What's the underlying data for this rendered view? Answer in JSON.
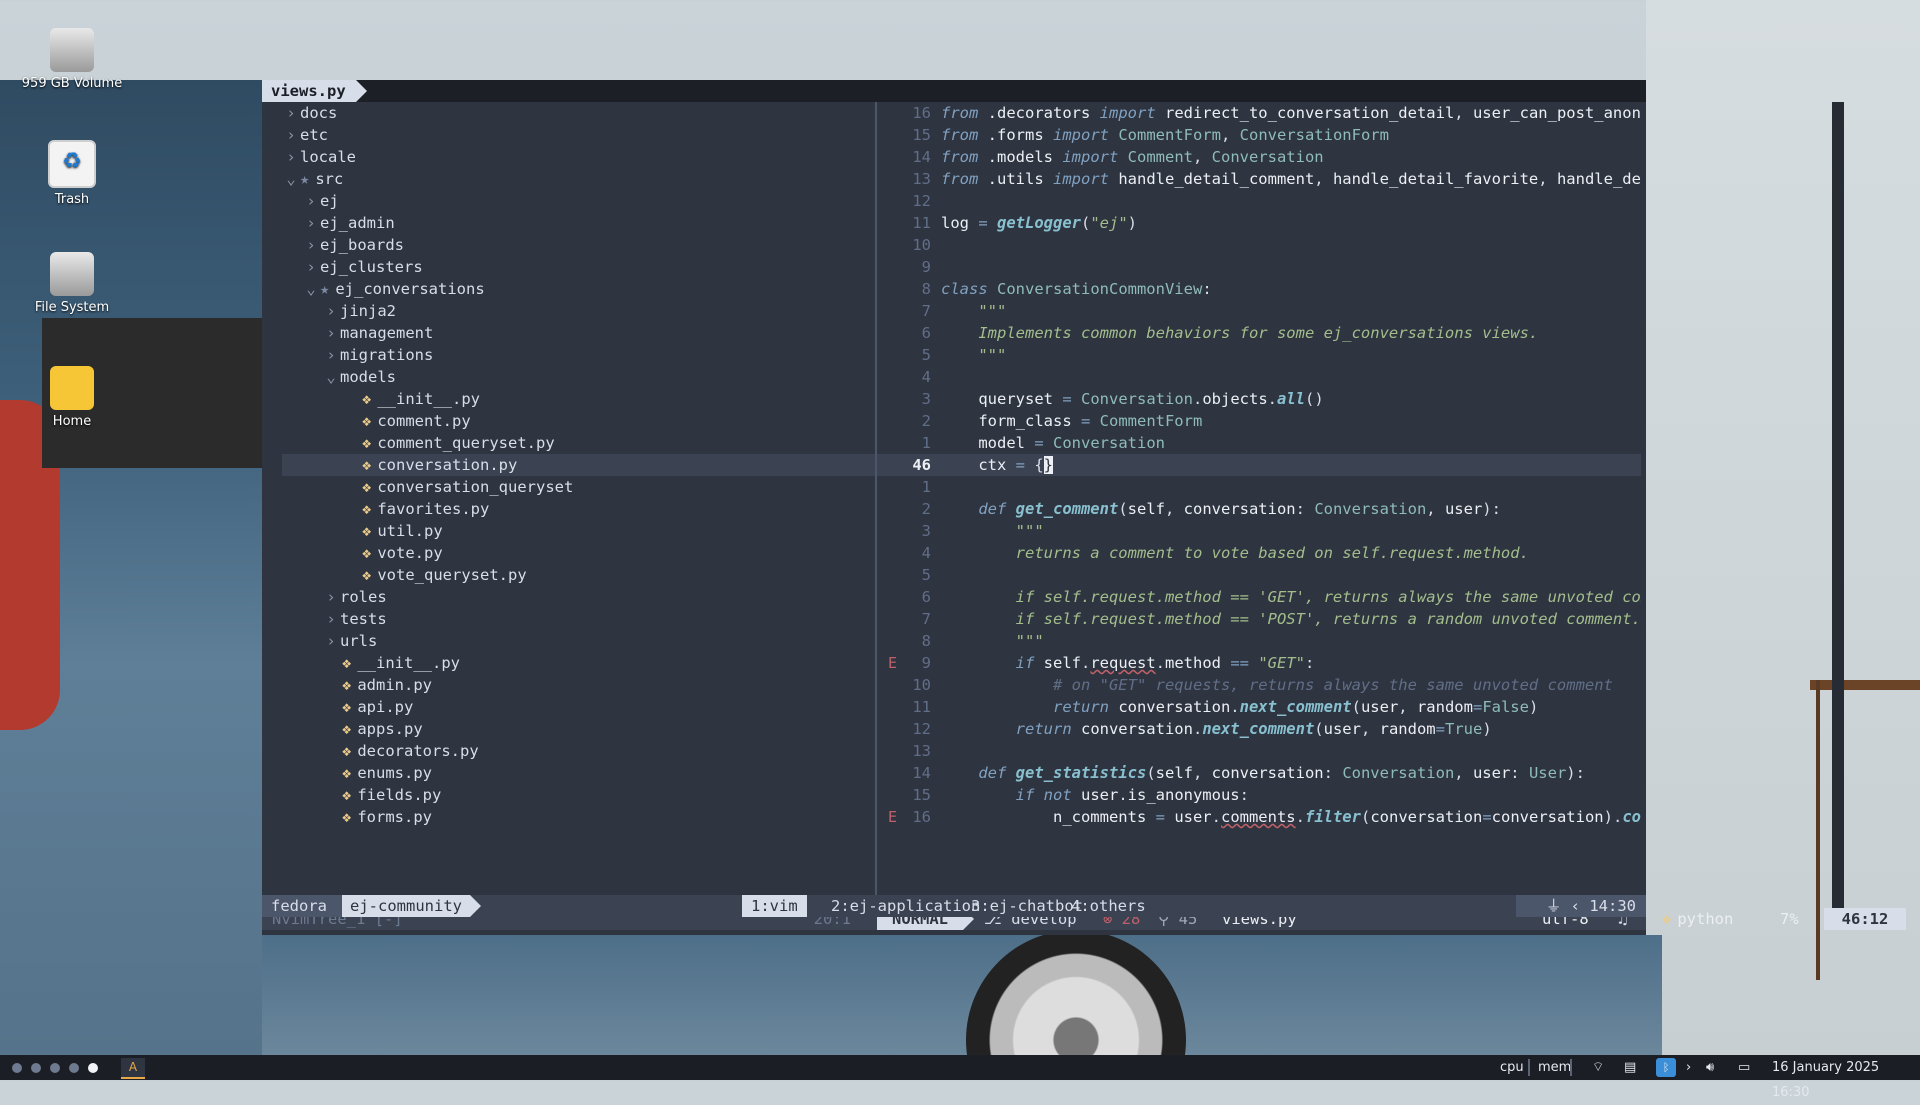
{
  "desktop": {
    "icons": [
      {
        "label": "959 GB Volume"
      },
      {
        "label": "Trash"
      },
      {
        "label": "File System"
      },
      {
        "label": "Home"
      }
    ]
  },
  "terminal": {
    "tab_title": "views.py",
    "tree": [
      {
        "depth": 2,
        "kind": "dir",
        "open": false,
        "name": "docs"
      },
      {
        "depth": 2,
        "kind": "dir",
        "open": false,
        "name": "etc"
      },
      {
        "depth": 2,
        "kind": "dir",
        "open": false,
        "name": "locale"
      },
      {
        "depth": 2,
        "kind": "dir",
        "open": true,
        "star": true,
        "name": "src"
      },
      {
        "depth": 3,
        "kind": "dir",
        "open": false,
        "name": "ej"
      },
      {
        "depth": 3,
        "kind": "dir",
        "open": false,
        "name": "ej_admin"
      },
      {
        "depth": 3,
        "kind": "dir",
        "open": false,
        "name": "ej_boards"
      },
      {
        "depth": 3,
        "kind": "dir",
        "open": false,
        "name": "ej_clusters"
      },
      {
        "depth": 3,
        "kind": "dir",
        "open": true,
        "star": true,
        "name": "ej_conversations"
      },
      {
        "depth": 4,
        "kind": "dir",
        "open": false,
        "name": "jinja2"
      },
      {
        "depth": 4,
        "kind": "dir",
        "open": false,
        "name": "management"
      },
      {
        "depth": 4,
        "kind": "dir",
        "open": false,
        "name": "migrations"
      },
      {
        "depth": 4,
        "kind": "dir",
        "open": true,
        "name": "models"
      },
      {
        "depth": 5,
        "kind": "py",
        "name": "__init__.py"
      },
      {
        "depth": 5,
        "kind": "py",
        "name": "comment.py"
      },
      {
        "depth": 5,
        "kind": "py",
        "name": "comment_queryset.py"
      },
      {
        "depth": 5,
        "kind": "py",
        "name": "conversation.py",
        "selected": true
      },
      {
        "depth": 5,
        "kind": "py",
        "name": "conversation_queryset"
      },
      {
        "depth": 5,
        "kind": "py",
        "name": "favorites.py"
      },
      {
        "depth": 5,
        "kind": "py",
        "name": "util.py"
      },
      {
        "depth": 5,
        "kind": "py",
        "name": "vote.py"
      },
      {
        "depth": 5,
        "kind": "py",
        "name": "vote_queryset.py"
      },
      {
        "depth": 4,
        "kind": "dir",
        "open": false,
        "name": "roles"
      },
      {
        "depth": 4,
        "kind": "dir",
        "open": false,
        "name": "tests"
      },
      {
        "depth": 4,
        "kind": "dir",
        "open": false,
        "name": "urls"
      },
      {
        "depth": 4,
        "kind": "py",
        "name": "__init__.py"
      },
      {
        "depth": 4,
        "kind": "py",
        "name": "admin.py"
      },
      {
        "depth": 4,
        "kind": "py",
        "name": "api.py"
      },
      {
        "depth": 4,
        "kind": "py",
        "name": "apps.py"
      },
      {
        "depth": 4,
        "kind": "py",
        "name": "decorators.py"
      },
      {
        "depth": 4,
        "kind": "py",
        "name": "enums.py"
      },
      {
        "depth": 4,
        "kind": "py",
        "name": "fields.py"
      },
      {
        "depth": 4,
        "kind": "py",
        "name": "forms.py"
      }
    ],
    "code": [
      {
        "n": "16",
        "t": [
          [
            "kw",
            "from "
          ],
          [
            "id",
            ".decorators "
          ],
          [
            "kw",
            "import "
          ],
          [
            "id",
            "redirect_to_conversation_detail"
          ],
          [
            "pun",
            ", "
          ],
          [
            "id",
            "user_can_post_anonymously"
          ]
        ]
      },
      {
        "n": "15",
        "t": [
          [
            "kw",
            "from "
          ],
          [
            "id",
            ".forms "
          ],
          [
            "kw",
            "import "
          ],
          [
            "cls",
            "CommentForm"
          ],
          [
            "pun",
            ", "
          ],
          [
            "cls",
            "ConversationForm"
          ]
        ]
      },
      {
        "n": "14",
        "t": [
          [
            "kw",
            "from "
          ],
          [
            "id",
            ".models "
          ],
          [
            "kw",
            "import "
          ],
          [
            "cls",
            "Comment"
          ],
          [
            "pun",
            ", "
          ],
          [
            "cls",
            "Conversation"
          ]
        ]
      },
      {
        "n": "13",
        "t": [
          [
            "kw",
            "from "
          ],
          [
            "id",
            ".utils "
          ],
          [
            "kw",
            "import "
          ],
          [
            "id",
            "handle_detail_comment"
          ],
          [
            "pun",
            ", "
          ],
          [
            "id",
            "handle_detail_favorite"
          ],
          [
            "pun",
            ", "
          ],
          [
            "id",
            "handle_detail_vote"
          ]
        ]
      },
      {
        "n": "12",
        "t": []
      },
      {
        "n": "11",
        "t": [
          [
            "id",
            "log "
          ],
          [
            "op",
            "= "
          ],
          [
            "fn",
            "getLogger"
          ],
          [
            "pun",
            "("
          ],
          [
            "str",
            "\"ej\""
          ],
          [
            "pun",
            ")"
          ]
        ]
      },
      {
        "n": "10",
        "t": []
      },
      {
        "n": "9",
        "t": []
      },
      {
        "n": "8",
        "t": [
          [
            "kw",
            "class "
          ],
          [
            "cls",
            "ConversationCommonView"
          ],
          [
            "pun",
            ":"
          ]
        ]
      },
      {
        "n": "7",
        "t": [
          [
            "pad",
            "    "
          ],
          [
            "doc",
            "\"\"\""
          ]
        ]
      },
      {
        "n": "6",
        "t": [
          [
            "pad",
            "    "
          ],
          [
            "doc",
            "Implements common behaviors for some ej_conversations views."
          ]
        ]
      },
      {
        "n": "5",
        "t": [
          [
            "pad",
            "    "
          ],
          [
            "doc",
            "\"\"\""
          ]
        ]
      },
      {
        "n": "4",
        "t": []
      },
      {
        "n": "3",
        "t": [
          [
            "pad",
            "    "
          ],
          [
            "id",
            "queryset "
          ],
          [
            "op",
            "= "
          ],
          [
            "cls",
            "Conversation"
          ],
          [
            "pun",
            "."
          ],
          [
            "id",
            "objects"
          ],
          [
            "pun",
            "."
          ],
          [
            "fn",
            "all"
          ],
          [
            "pun",
            "()"
          ]
        ]
      },
      {
        "n": "2",
        "t": [
          [
            "pad",
            "    "
          ],
          [
            "id",
            "form_class "
          ],
          [
            "op",
            "= "
          ],
          [
            "cls",
            "CommentForm"
          ]
        ]
      },
      {
        "n": "1",
        "t": [
          [
            "pad",
            "    "
          ],
          [
            "id",
            "model "
          ],
          [
            "op",
            "= "
          ],
          [
            "cls",
            "Conversation"
          ]
        ]
      },
      {
        "n": "46",
        "cur": true,
        "t": [
          [
            "pad",
            "    "
          ],
          [
            "id",
            "ctx "
          ],
          [
            "op",
            "= "
          ],
          [
            "pun",
            "{"
          ],
          [
            "cursor",
            "}"
          ]
        ]
      },
      {
        "n": "1",
        "t": []
      },
      {
        "n": "2",
        "t": [
          [
            "pad",
            "    "
          ],
          [
            "kw",
            "def "
          ],
          [
            "fn",
            "get_comment"
          ],
          [
            "pun",
            "("
          ],
          [
            "id",
            "self"
          ],
          [
            "pun",
            ", "
          ],
          [
            "id",
            "conversation"
          ],
          [
            "pun",
            ": "
          ],
          [
            "cls",
            "Conversation"
          ],
          [
            "pun",
            ", "
          ],
          [
            "id",
            "user"
          ],
          [
            "pun",
            "):"
          ]
        ]
      },
      {
        "n": "3",
        "t": [
          [
            "pad",
            "        "
          ],
          [
            "doc",
            "\"\"\""
          ]
        ]
      },
      {
        "n": "4",
        "t": [
          [
            "pad",
            "        "
          ],
          [
            "doc",
            "returns a comment to vote based on self.request.method."
          ]
        ]
      },
      {
        "n": "5",
        "t": []
      },
      {
        "n": "6",
        "t": [
          [
            "pad",
            "        "
          ],
          [
            "doc",
            "if self.request.method == 'GET', returns always the same unvoted comment."
          ]
        ]
      },
      {
        "n": "7",
        "t": [
          [
            "pad",
            "        "
          ],
          [
            "doc",
            "if self.request.method == 'POST', returns a random unvoted comment."
          ]
        ]
      },
      {
        "n": "8",
        "t": [
          [
            "pad",
            "        "
          ],
          [
            "doc",
            "\"\"\""
          ]
        ]
      },
      {
        "n": "9",
        "sign": "E",
        "t": [
          [
            "pad",
            "        "
          ],
          [
            "kw",
            "if "
          ],
          [
            "id",
            "self"
          ],
          [
            "pun",
            "."
          ],
          [
            "warn",
            "request"
          ],
          [
            "pun",
            "."
          ],
          [
            "id",
            "method "
          ],
          [
            "op",
            "== "
          ],
          [
            "str",
            "\"GET\""
          ],
          [
            "pun",
            ":"
          ]
        ]
      },
      {
        "n": "10",
        "t": [
          [
            "pad",
            "            "
          ],
          [
            "cm",
            "# on \"GET\" requests, returns always the same unvoted comment"
          ]
        ]
      },
      {
        "n": "11",
        "t": [
          [
            "pad",
            "            "
          ],
          [
            "kw",
            "return "
          ],
          [
            "id",
            "conversation"
          ],
          [
            "pun",
            "."
          ],
          [
            "fn",
            "next_comment"
          ],
          [
            "pun",
            "("
          ],
          [
            "id",
            "user"
          ],
          [
            "pun",
            ", "
          ],
          [
            "id",
            "random"
          ],
          [
            "op",
            "="
          ],
          [
            "cls",
            "False"
          ],
          [
            "pun",
            ")"
          ]
        ]
      },
      {
        "n": "12",
        "t": [
          [
            "pad",
            "        "
          ],
          [
            "kw",
            "return "
          ],
          [
            "id",
            "conversation"
          ],
          [
            "pun",
            "."
          ],
          [
            "fn",
            "next_comment"
          ],
          [
            "pun",
            "("
          ],
          [
            "id",
            "user"
          ],
          [
            "pun",
            ", "
          ],
          [
            "id",
            "random"
          ],
          [
            "op",
            "="
          ],
          [
            "cls",
            "True"
          ],
          [
            "pun",
            ")"
          ]
        ]
      },
      {
        "n": "13",
        "t": []
      },
      {
        "n": "14",
        "t": [
          [
            "pad",
            "    "
          ],
          [
            "kw",
            "def "
          ],
          [
            "fn",
            "get_statistics"
          ],
          [
            "pun",
            "("
          ],
          [
            "id",
            "self"
          ],
          [
            "pun",
            ", "
          ],
          [
            "id",
            "conversation"
          ],
          [
            "pun",
            ": "
          ],
          [
            "cls",
            "Conversation"
          ],
          [
            "pun",
            ", "
          ],
          [
            "id",
            "user"
          ],
          [
            "pun",
            ": "
          ],
          [
            "cls",
            "User"
          ],
          [
            "pun",
            "):"
          ]
        ]
      },
      {
        "n": "15",
        "t": [
          [
            "pad",
            "        "
          ],
          [
            "kw",
            "if not "
          ],
          [
            "id",
            "user"
          ],
          [
            "pun",
            "."
          ],
          [
            "id",
            "is_anonymous"
          ],
          [
            "pun",
            ":"
          ]
        ]
      },
      {
        "n": "16",
        "sign": "E",
        "t": [
          [
            "pad",
            "            "
          ],
          [
            "id",
            "n_comments "
          ],
          [
            "op",
            "= "
          ],
          [
            "id",
            "user"
          ],
          [
            "pun",
            "."
          ],
          [
            "warn",
            "comments"
          ],
          [
            "pun",
            "."
          ],
          [
            "fn",
            "filter"
          ],
          [
            "pun",
            "("
          ],
          [
            "id",
            "conversation"
          ],
          [
            "op",
            "="
          ],
          [
            "id",
            "conversation"
          ],
          [
            "pun",
            ")."
          ],
          [
            "fn",
            "count"
          ],
          [
            "pun",
            "()"
          ]
        ]
      }
    ],
    "status": {
      "tree_name": "NvimTree_1 [-]",
      "tree_pos": "20:1",
      "mode": "NORMAL",
      "branch": " develop",
      "errors": "⊗ 28",
      "hints": "⚲ 45",
      "file": "views.py",
      "encoding": "utf-8",
      "bell": "♫",
      "language": "python",
      "percent": "7%",
      "position": "46:12"
    },
    "tmux": {
      "host": "fedora",
      "session": "ej-community",
      "windows": [
        {
          "label": "1:vim",
          "active": true
        },
        {
          "label": "2:ej-application"
        },
        {
          "label": "3:ej-chatbot"
        },
        {
          "label": "4:others"
        }
      ],
      "time": "14:30"
    }
  },
  "taskbar": {
    "workspaces": [
      false,
      false,
      false,
      false,
      true
    ],
    "cpu_label": "cpu",
    "mem_label": "mem",
    "datetime": "16 January 2025 16:30"
  },
  "colors": {
    "editor_bg": "#2e3440",
    "accent": "#d8dee9",
    "error": "#bf616a",
    "python_icon": "#ebcb8b"
  }
}
